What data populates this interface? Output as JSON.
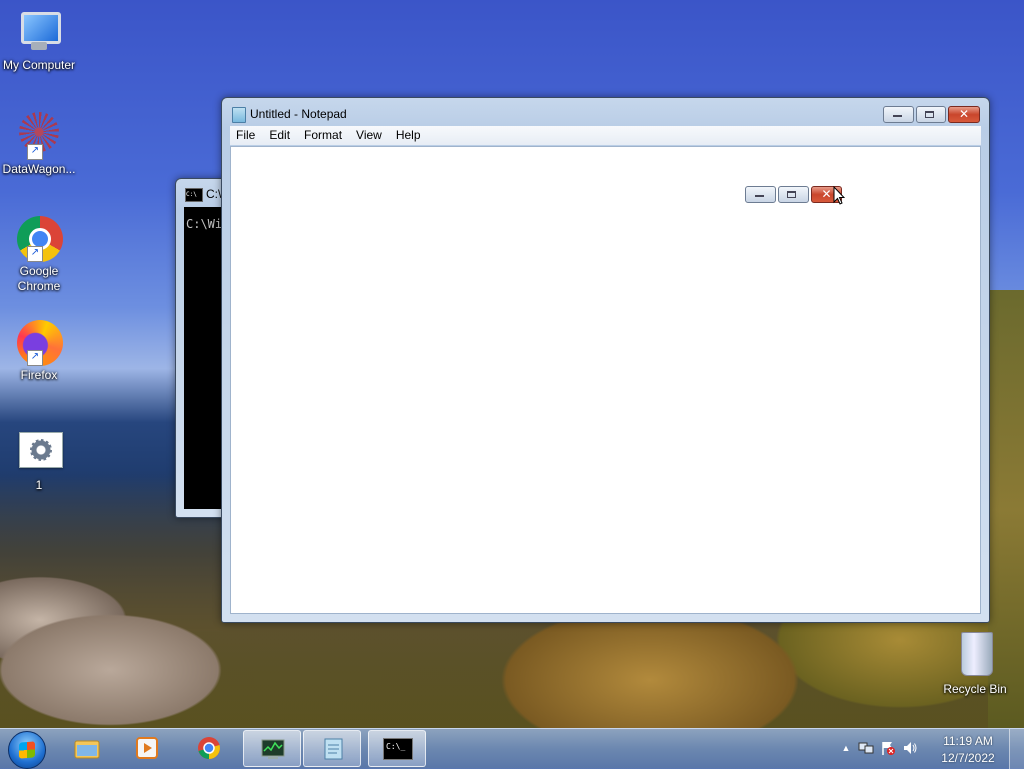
{
  "desktop": {
    "icons": [
      {
        "label": "My Computer",
        "icon": "computer-icon"
      },
      {
        "label": "DataWagon...",
        "icon": "datawagon-icon"
      },
      {
        "label": "Google\nChrome",
        "line1": "Google",
        "line2": "Chrome",
        "icon": "chrome-icon"
      },
      {
        "label": "Firefox",
        "icon": "firefox-icon"
      },
      {
        "label": "1",
        "icon": "settings-gear-icon"
      },
      {
        "label": "Recycle Bin",
        "icon": "recycle-bin-icon"
      }
    ]
  },
  "console": {
    "title": "C:\\",
    "text": "C:\\Wi"
  },
  "notepad": {
    "title": "Untitled - Notepad",
    "menu": [
      "File",
      "Edit",
      "Format",
      "View",
      "Help"
    ],
    "content": ""
  },
  "taskbar": {
    "apps": [
      "start-button",
      "file-explorer-icon",
      "media-player-icon",
      "chrome-icon",
      "task-manager-icon",
      "notepad-icon",
      "command-prompt-icon"
    ],
    "active": [
      "task-manager-icon",
      "notepad-icon",
      "command-prompt-icon"
    ],
    "console_glyph": "C:\\_"
  },
  "tray": {
    "show_hidden": "▲",
    "time": "11:19 AM",
    "date": "12/7/2022"
  },
  "colors": {
    "close_button": "#c9462c",
    "title_bar": "#c6d7ec",
    "taskbar": "#6e8cbe"
  }
}
